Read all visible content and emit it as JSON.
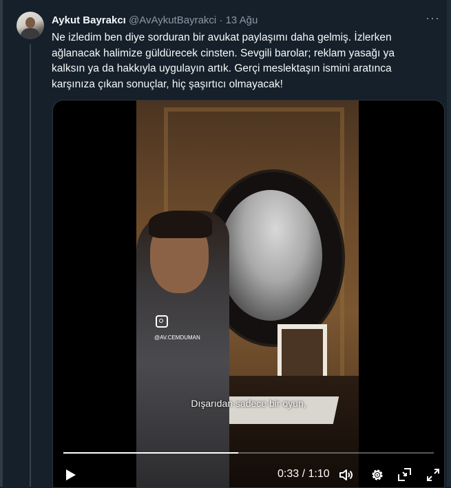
{
  "tweet": {
    "author_name": "Aykut Bayrakcı",
    "handle": "@AvAykutBayrakci",
    "separator": "·",
    "time": "13 Ağu",
    "more": "···",
    "text_lines": [
      "Ne izledim ben diye sorduran bir avukat paylaşımı daha gelmiş. İzlerken",
      "ağlanacak halimize güldürecek cinsten. Sevgili barolar; reklam yasağı ya",
      "kalksın ya da hakkıyla uygulayın artık. Gerçi meslektaşın ismini aratınca",
      "karşınıza çıkan sonuçlar, hiç şaşırtıcı olmayacak!"
    ]
  },
  "video": {
    "watermark_handle": "@AV.CEMDUMAN",
    "subtitle": "Dışarıdan sadece bir oyun,",
    "current_time": "0:33",
    "duration": "1:10",
    "timecode": "0:33 / 1:10",
    "progress": 0.4714,
    "controls": [
      "play-icon",
      "volume-icon",
      "settings-gear-icon",
      "pip-icon",
      "fullscreen-icon"
    ]
  },
  "colors": {
    "background": "#15202b",
    "text": "#f7f9f9",
    "muted": "#8b98a5",
    "thread_line": "#38444d"
  }
}
